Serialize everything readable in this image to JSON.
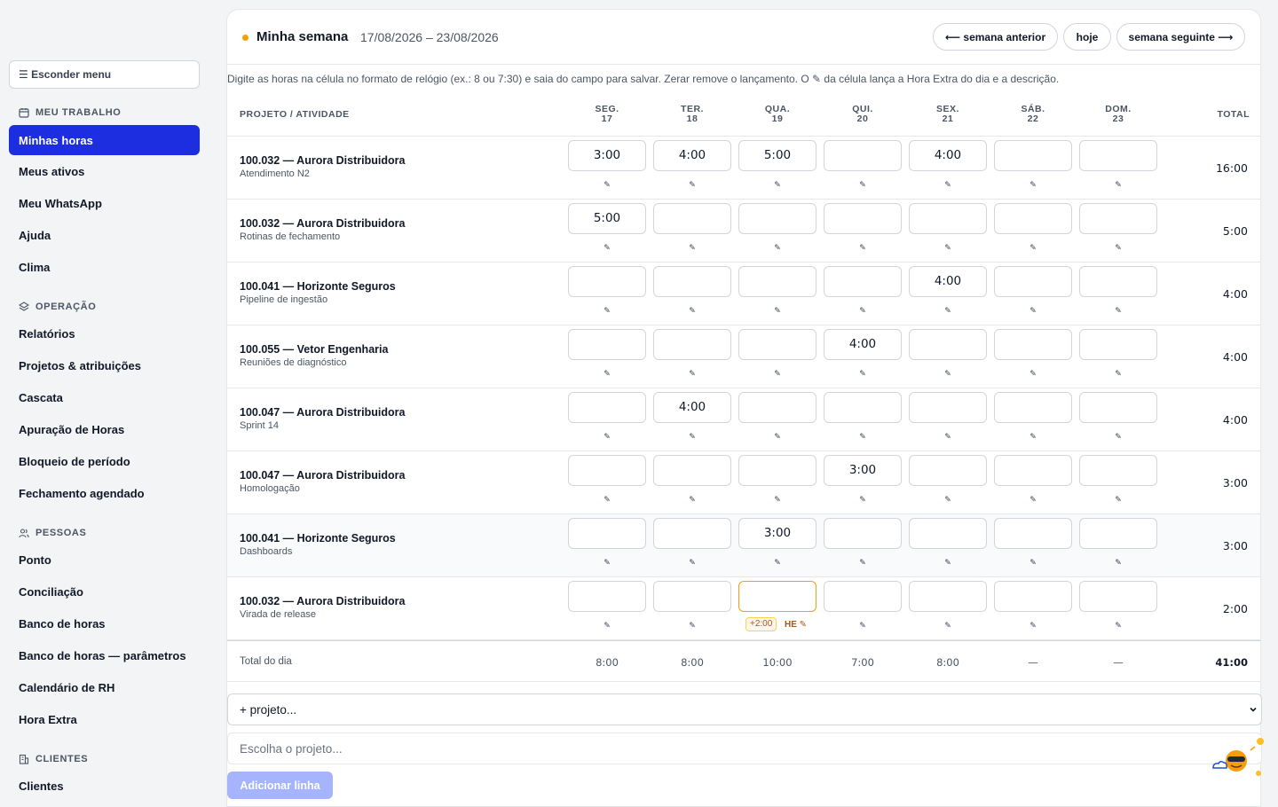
{
  "sidebar": {
    "hide_menu": "☰ Esconder menu",
    "sections": [
      {
        "title": "MEU TRABALHO",
        "items": [
          "Minhas horas",
          "Meus ativos",
          "Meu WhatsApp",
          "Ajuda",
          "Clima"
        ]
      },
      {
        "title": "OPERAÇÃO",
        "items": [
          "Relatórios",
          "Projetos & atribuições",
          "Cascata",
          "Apuração de Horas",
          "Bloqueio de período",
          "Fechamento agendado"
        ]
      },
      {
        "title": "PESSOAS",
        "items": [
          "Ponto",
          "Conciliação",
          "Banco de horas",
          "Banco de horas — parâmetros",
          "Calendário de RH",
          "Hora Extra"
        ]
      },
      {
        "title": "CLIENTES",
        "items": [
          "Clientes"
        ]
      }
    ]
  },
  "header": {
    "title": "Minha semana",
    "range": "17/08/2026 – 23/08/2026",
    "prev": "⟵ semana anterior",
    "today": "hoje",
    "next": "semana seguinte ⟶"
  },
  "hint": "Digite as horas na célula no formato de relógio (ex.: 8 ou 7:30) e saia do campo para salvar. Zerar remove o lançamento. O ✎ da célula lança a Hora Extra do dia e a descrição.",
  "table": {
    "col_project": "PROJETO / ATIVIDADE",
    "col_total": "TOTAL",
    "days": [
      {
        "name": "SEG.",
        "num": "17"
      },
      {
        "name": "TER.",
        "num": "18"
      },
      {
        "name": "QUA.",
        "num": "19"
      },
      {
        "name": "QUI.",
        "num": "20"
      },
      {
        "name": "SEX.",
        "num": "21"
      },
      {
        "name": "SÁB.",
        "num": "22"
      },
      {
        "name": "DOM.",
        "num": "23"
      }
    ],
    "rows": [
      {
        "project": "100.032 — Aurora Distribuidora",
        "activity": "Atendimento N2",
        "hours": [
          "3:00",
          "4:00",
          "5:00",
          "",
          "4:00",
          "",
          ""
        ],
        "total": "16:00"
      },
      {
        "project": "100.032 — Aurora Distribuidora",
        "activity": "Rotinas de fechamento",
        "hours": [
          "5:00",
          "",
          "",
          "",
          "",
          "",
          ""
        ],
        "total": "5:00"
      },
      {
        "project": "100.041 — Horizonte Seguros",
        "activity": "Pipeline de ingestão",
        "hours": [
          "",
          "",
          "",
          "",
          "4:00",
          "",
          ""
        ],
        "total": "4:00"
      },
      {
        "project": "100.055 — Vetor Engenharia",
        "activity": "Reuniões de diagnóstico",
        "hours": [
          "",
          "",
          "",
          "4:00",
          "",
          "",
          ""
        ],
        "total": "4:00"
      },
      {
        "project": "100.047 — Aurora Distribuidora",
        "activity": "Sprint 14",
        "hours": [
          "",
          "4:00",
          "",
          "",
          "",
          "",
          ""
        ],
        "total": "4:00"
      },
      {
        "project": "100.047 — Aurora Distribuidora",
        "activity": "Homologação",
        "hours": [
          "",
          "",
          "",
          "3:00",
          "",
          "",
          ""
        ],
        "total": "3:00"
      },
      {
        "project": "100.041 — Horizonte Seguros",
        "activity": "Dashboards",
        "hours": [
          "",
          "",
          "3:00",
          "",
          "",
          "",
          ""
        ],
        "total": "3:00"
      },
      {
        "project": "100.032 — Aurora Distribuidora",
        "activity": "Virada de release",
        "hours": [
          "",
          "",
          "",
          "",
          "",
          "",
          ""
        ],
        "total": "2:00"
      }
    ],
    "overtime": {
      "badge": "+2:00",
      "label": "HE ✎"
    },
    "day_total_label": "Total do dia",
    "day_totals": [
      "8:00",
      "8:00",
      "10:00",
      "7:00",
      "8:00",
      "—",
      "—"
    ],
    "grand_total": "41:00"
  },
  "footer": {
    "select_value": "+ projeto...",
    "search_placeholder": "Escolha o projeto...",
    "add_button": "Adicionar linha"
  },
  "colors": {
    "accent": "#1d2ee0",
    "dot": "#f59e0b",
    "add_button": "#a5b4fc"
  }
}
